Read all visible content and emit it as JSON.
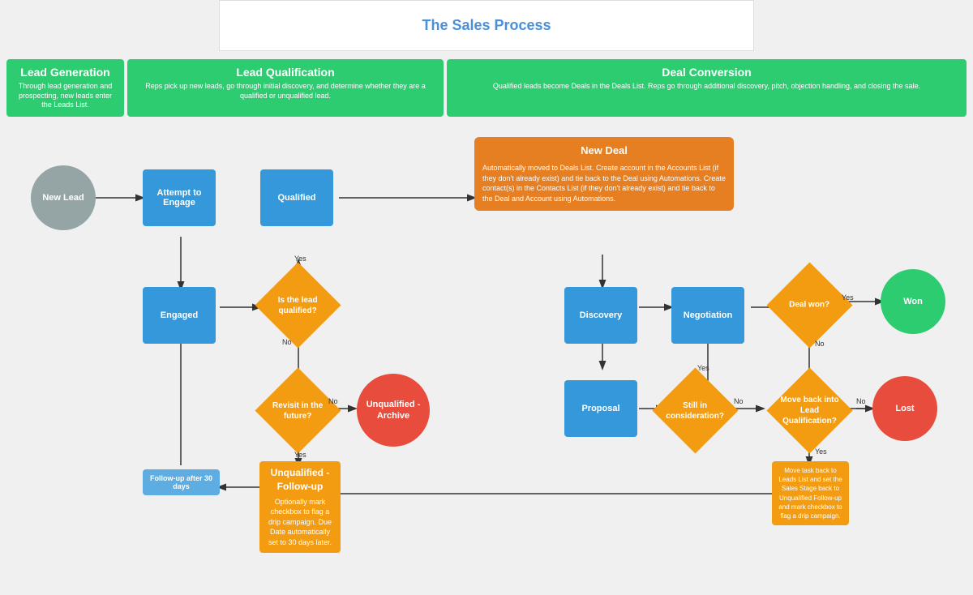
{
  "title": "The Sales Process",
  "phases": [
    {
      "id": "lead-gen",
      "label": "Lead Generation",
      "description": "Through lead generation and prospecting, new leads enter the Leads List."
    },
    {
      "id": "lead-qual",
      "label": "Lead Qualification",
      "description": "Reps pick up new leads, go through initial discovery, and determine whether they are a qualified or unqualified lead."
    },
    {
      "id": "deal-conv",
      "label": "Deal Conversion",
      "description": "Qualified leads become Deals in the Deals List. Reps go through additional discovery, pitch, objection handling, and closing the sale."
    }
  ],
  "nodes": {
    "new_lead": "New Lead",
    "attempt_engage": "Attempt to Engage",
    "engaged": "Engaged",
    "qualified": "Qualified",
    "is_lead_qualified": "Is the lead qualified?",
    "revisit_future": "Revisit in the future?",
    "unqualified_archive": "Unqualified - Archive",
    "unqualified_followup_title": "Unqualified - Follow-up",
    "unqualified_followup_desc": "Optionally mark checkbox to flag a drip campaign. Due Date automatically set to 30 days later.",
    "followup_after": "Follow-up after 30 days",
    "new_deal_title": "New Deal",
    "new_deal_desc": "Automatically moved to Deals List. Create account in the Accounts List (if they don't already exist) and tie back to the Deal using Automations. Create contact(s) in the Contacts List (if they don't already exist) and tie back to the Deal and Account using Automations.",
    "discovery": "Discovery",
    "negotiation": "Negotiation",
    "proposal": "Proposal",
    "deal_won": "Deal won?",
    "still_in_consideration": "Still in consideration?",
    "move_back_lq": "Move back into Lead Qualification?",
    "won": "Won",
    "lost": "Lost",
    "move_back_desc": "Move task back to Leads List and set the Sales Stage back to Unqualified Follow-up and mark checkbox to flag a drip campaign.",
    "yes": "Yes",
    "no": "No"
  }
}
